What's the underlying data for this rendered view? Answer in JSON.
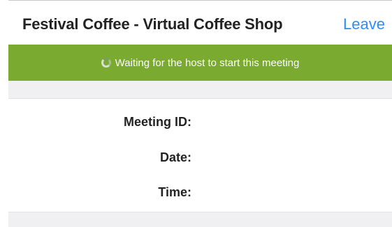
{
  "header": {
    "title": "Festival Coffee - Virtual Coffee Shop",
    "leave_label": "Leave"
  },
  "banner": {
    "status_text": "Waiting for the host to start this meeting",
    "icon": "loading-spinner-icon",
    "color": "#7aaa2f"
  },
  "details": {
    "meeting_id_label": "Meeting ID:",
    "date_label": "Date:",
    "time_label": "Time:"
  },
  "colors": {
    "link": "#2d8cff",
    "text": "#232323",
    "divider_background": "#f0f0f2"
  }
}
